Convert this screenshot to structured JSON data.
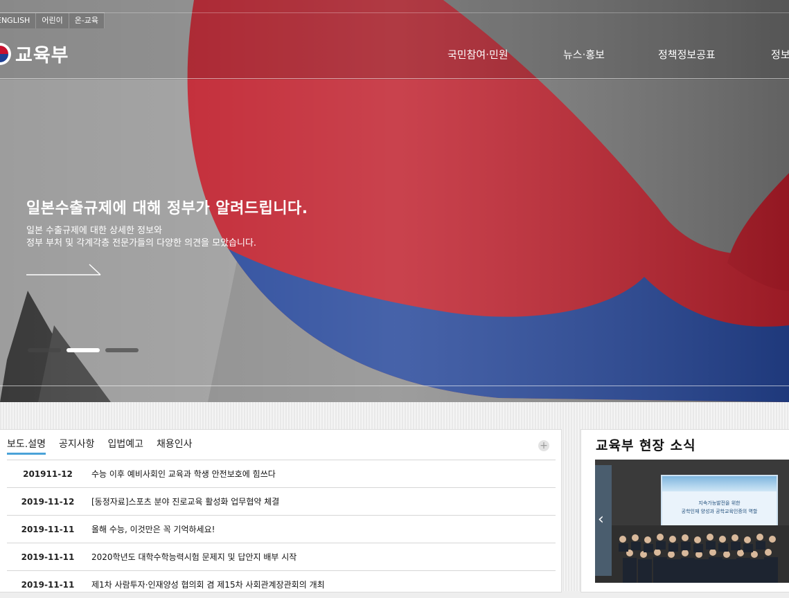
{
  "utility_links": [
    "ENGLISH",
    "어린이",
    "온-교육"
  ],
  "logo": {
    "text": "교육부"
  },
  "gnb": [
    "국민참여·민원",
    "뉴스·홍보",
    "정책정보공표",
    "정보"
  ],
  "slide": {
    "title": "일본수출규제에 대해 정부가 알려드립니다.",
    "desc_line1": "일본 수출규제에 대한 상세한 정보와",
    "desc_line2": "정부 부처 및 각계각층 전문가들의 다양한 의견을 모았습니다.",
    "pager_count": 3,
    "pager_active": 2
  },
  "news": {
    "tabs": [
      "보도.설명",
      "공지사항",
      "입법예고",
      "채용인사"
    ],
    "active_tab": 0,
    "more_label": "+",
    "items": [
      {
        "date": "201911-12",
        "title": "수능 이후 예비사회인 교육과 학생 안전보호에 힘쓰다"
      },
      {
        "date": "2019-11-12",
        "title": "[동정자료]스포츠 분야 진로교육 활성화 업무협약 체결"
      },
      {
        "date": "2019-11-11",
        "title": "올해 수능, 이것만은 꼭 기억하세요!"
      },
      {
        "date": "2019-11-11",
        "title": "2020학년도 대학수학능력시험 문제지 및 답안지 배부 시작"
      },
      {
        "date": "2019-11-11",
        "title": "제1차 사람투자·인재양성 협의회 겸 제15차 사회관계장관회의 개최"
      }
    ]
  },
  "field_news": {
    "title": "교육부 현장 소식",
    "banner_line1": "지속가능발전을 위한",
    "banner_line2": "공학인재 양성과 공학교육인증의 역할",
    "prev_icon": "‹"
  },
  "colors": {
    "accent": "#4aa3d8",
    "flag_red": "#c8102e",
    "flag_blue": "#1c3f94"
  }
}
